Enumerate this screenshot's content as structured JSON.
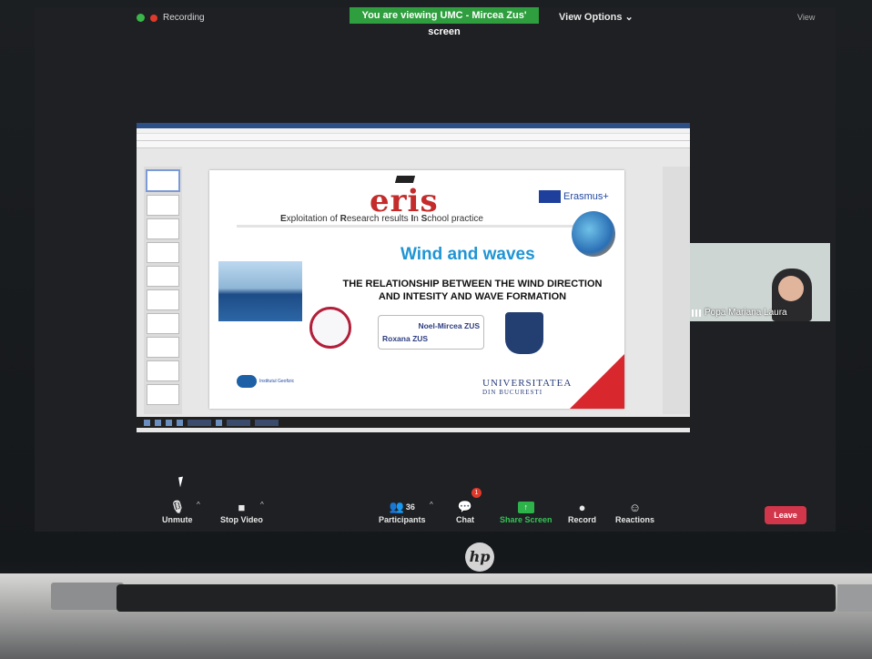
{
  "topbar": {
    "recording_label": "Recording",
    "viewing_banner": "You are viewing UMC - Mircea Zus' screen",
    "view_options": "View Options",
    "view_options_caret": "⌄",
    "gallery_label": "View"
  },
  "slide": {
    "logo": "eris",
    "subtitle_parts": [
      "E",
      "xploitation of ",
      "R",
      "esearch results ",
      "I",
      "n ",
      "S",
      "chool practice"
    ],
    "erasmus": "Erasmus+",
    "title": "Wind and waves",
    "relationship_line1": "THE RELATIONSHIP BETWEEN THE WIND DIRECTION",
    "relationship_line2": "AND INTESITY AND WAVE FORMATION",
    "author1": "Noel-Mircea ZUS",
    "author2": "Roxana ZUS",
    "institute": "Institutul Geofizic",
    "university": "UNIVERSITATEA",
    "university_sub": "DIN BUCURESTI"
  },
  "participant_video": {
    "name": "Popa Mariana Laura"
  },
  "toolbar": {
    "unmute": "Unmute",
    "stop_video": "Stop Video",
    "participants": "Participants",
    "participants_count": "36",
    "chat": "Chat",
    "chat_badge": "1",
    "share_screen": "Share Screen",
    "record": "Record",
    "reactions": "Reactions",
    "leave": "Leave"
  },
  "brand": {
    "laptop_logo": "hp"
  },
  "colors": {
    "viewing_banner": "#2e9e3e",
    "leave": "#d2364a",
    "share_screen": "#2db34a",
    "slide_title": "#1f95d4",
    "eris_red": "#c42b2b"
  }
}
